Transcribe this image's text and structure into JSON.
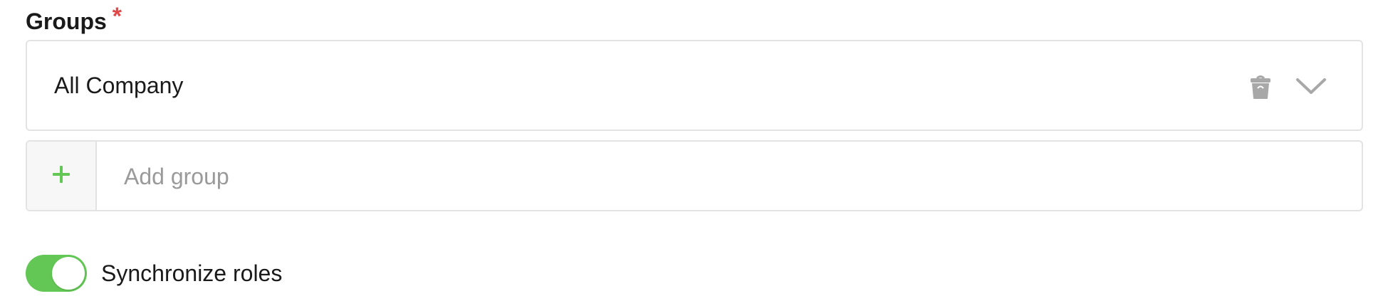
{
  "groups_field": {
    "label": "Groups",
    "required_marker": "*",
    "selected_group": "All Company",
    "add_placeholder": "Add group"
  },
  "sync_roles": {
    "label": "Synchronize roles",
    "enabled": true
  },
  "icons": {
    "delete": "trash-icon",
    "expand": "chevron-down-icon",
    "add": "plus-icon"
  },
  "colors": {
    "accent_green": "#62c754",
    "required_red": "#e34848",
    "border": "#e3e3e3",
    "icon_gray": "#a8a8a8",
    "placeholder_gray": "#9a9a9a"
  }
}
